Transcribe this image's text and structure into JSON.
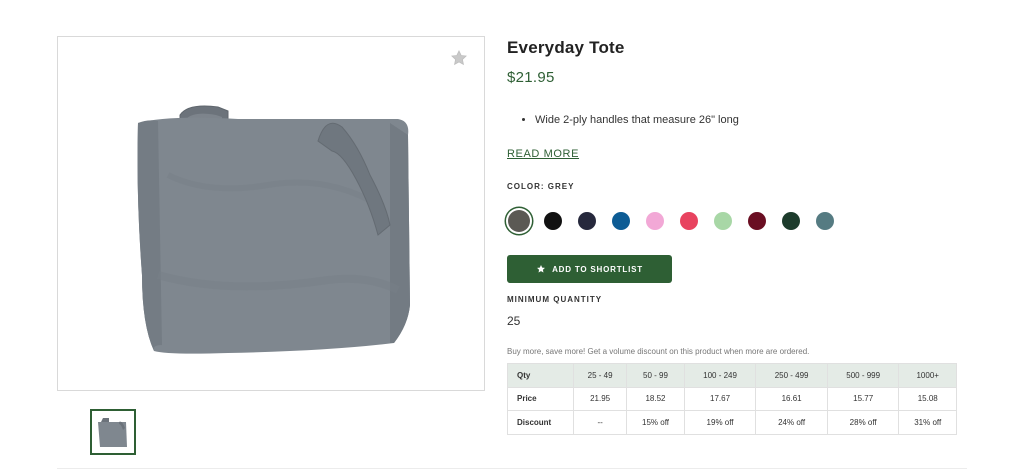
{
  "product": {
    "title": "Everyday Tote",
    "price": "$21.95",
    "features": [
      "Wide 2-ply handles that measure 26\" long"
    ],
    "read_more": "READ MORE",
    "color_label": "COLOR: GREY",
    "colors": [
      {
        "name": "grey",
        "hex": "#5b5954",
        "selected": true
      },
      {
        "name": "black",
        "hex": "#111111"
      },
      {
        "name": "navy",
        "hex": "#26283c"
      },
      {
        "name": "royal-blue",
        "hex": "#0d5c95"
      },
      {
        "name": "pink",
        "hex": "#f2a8d6"
      },
      {
        "name": "hot-pink",
        "hex": "#e8435f"
      },
      {
        "name": "mint",
        "hex": "#a8d7a6"
      },
      {
        "name": "burgundy",
        "hex": "#6a0e22"
      },
      {
        "name": "forest-green",
        "hex": "#1d3c2c"
      },
      {
        "name": "slate",
        "hex": "#557b82"
      }
    ],
    "add_button": "ADD TO SHORTLIST",
    "min_qty_label": "MINIMUM QUANTITY",
    "min_qty": "25",
    "volume_note": "Buy more, save more! Get a volume discount on this product when more are ordered."
  },
  "pricing": {
    "headers": [
      "Qty",
      "25 - 49",
      "50 - 99",
      "100 - 249",
      "250 - 499",
      "500 - 999",
      "1000+"
    ],
    "rows": [
      [
        "Price",
        "21.95",
        "18.52",
        "17.67",
        "16.61",
        "15.77",
        "15.08"
      ],
      [
        "Discount",
        "--",
        "15% off",
        "19% off",
        "24% off",
        "28% off",
        "31% off"
      ]
    ]
  },
  "icons": {
    "favorite": "star-icon",
    "button": "star-icon"
  },
  "accent_color": "#2e5f34",
  "bag_color": "#7f878f"
}
